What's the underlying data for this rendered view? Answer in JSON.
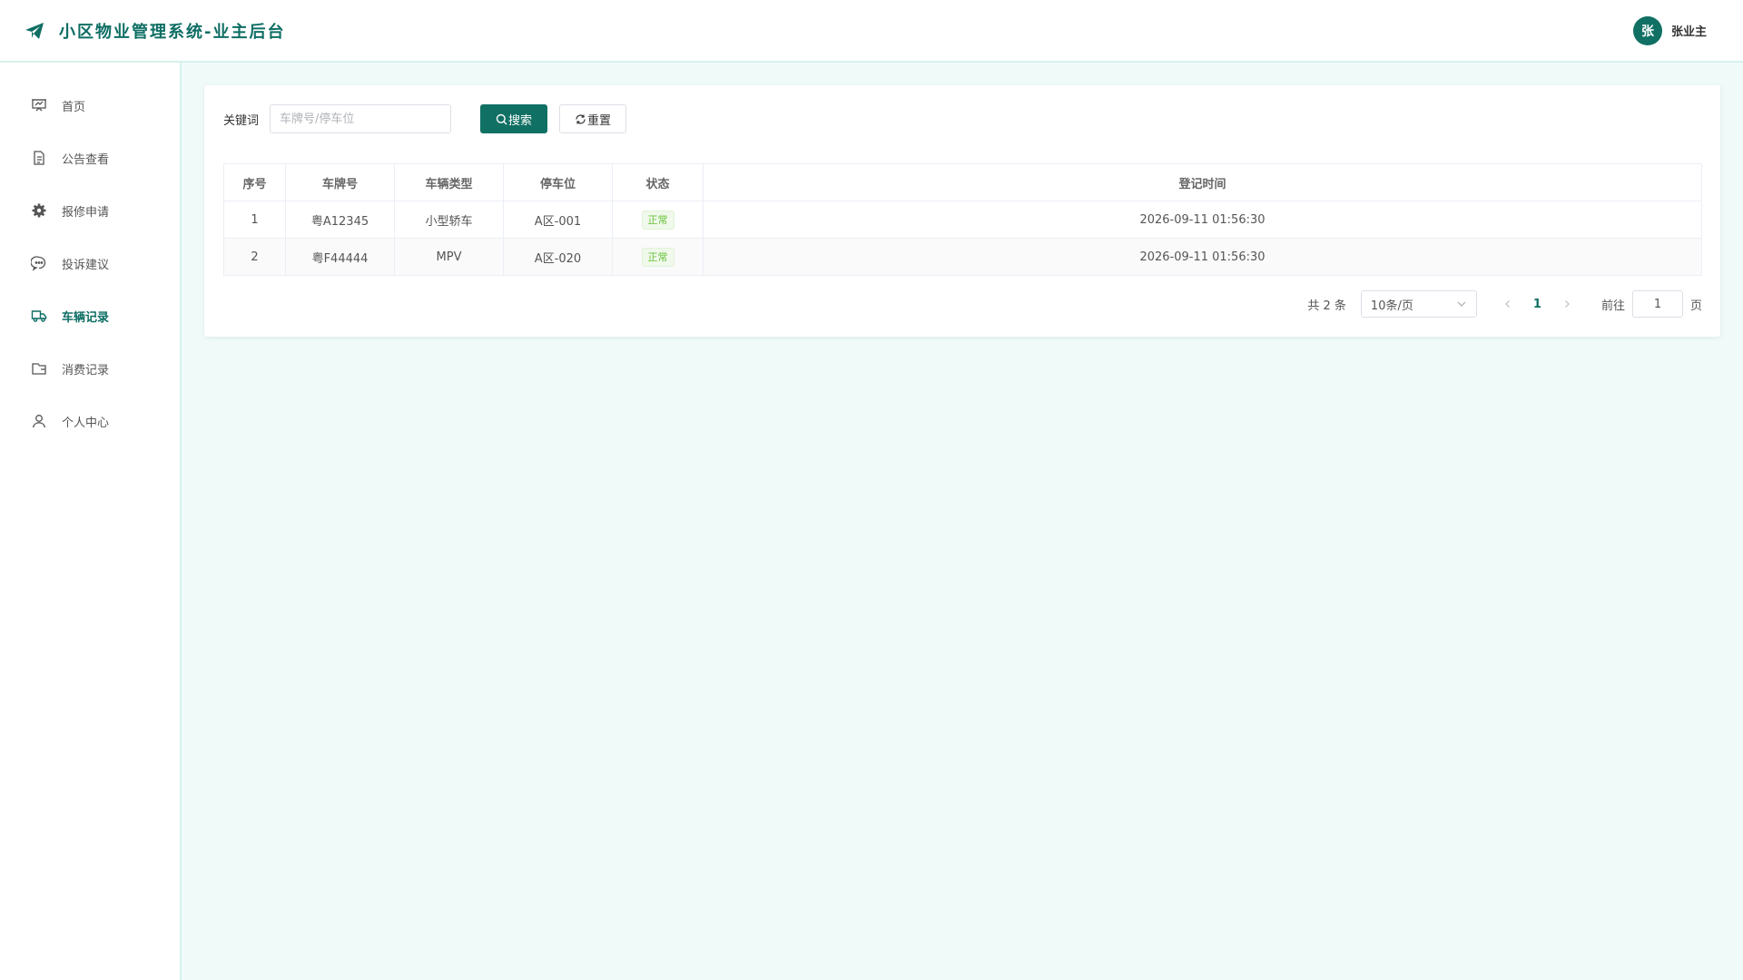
{
  "header": {
    "title": "小区物业管理系统-业主后台",
    "avatar_text": "张",
    "username": "张业主",
    "accent": "#117064"
  },
  "sidebar": {
    "items": [
      {
        "label": "首页",
        "icon": "presentation-icon"
      },
      {
        "label": "公告查看",
        "icon": "document-icon"
      },
      {
        "label": "报修申请",
        "icon": "gear-icon"
      },
      {
        "label": "投诉建议",
        "icon": "chat-bubble-icon"
      },
      {
        "label": "车辆记录",
        "icon": "truck-icon",
        "active": true
      },
      {
        "label": "消费记录",
        "icon": "wallet-icon"
      },
      {
        "label": "个人中心",
        "icon": "user-icon"
      }
    ]
  },
  "search": {
    "label": "关键词",
    "placeholder": "车牌号/停车位",
    "value": "",
    "search_button": "搜索",
    "reset_button": "重置"
  },
  "table": {
    "columns": [
      "序号",
      "车牌号",
      "车辆类型",
      "停车位",
      "状态",
      "登记时间"
    ],
    "rows": [
      {
        "index": "1",
        "plate": "粤A12345",
        "type": "小型轿车",
        "spot": "A区-001",
        "status": "正常",
        "time": "2026-09-11 01:56:30"
      },
      {
        "index": "2",
        "plate": "粤F44444",
        "type": "MPV",
        "spot": "A区-020",
        "status": "正常",
        "time": "2026-09-11 01:56:30"
      }
    ]
  },
  "pagination": {
    "total_text": "共 2 条",
    "page_size": "10条/页",
    "current_page": "1",
    "goto_label": "前往",
    "goto_value": "1",
    "page_suffix": "页"
  }
}
